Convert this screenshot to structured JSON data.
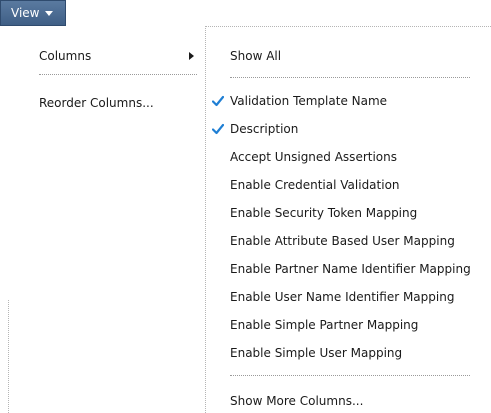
{
  "toolbar": {
    "view_label": "View"
  },
  "view_menu": {
    "items": [
      {
        "label": "Columns",
        "has_submenu": true
      },
      {
        "label": "Reorder Columns..."
      }
    ]
  },
  "columns_submenu": {
    "show_all_label": "Show All",
    "columns": [
      {
        "label": "Validation Template Name",
        "checked": true
      },
      {
        "label": "Description",
        "checked": true
      },
      {
        "label": "Accept Unsigned Assertions",
        "checked": false
      },
      {
        "label": "Enable Credential Validation",
        "checked": false
      },
      {
        "label": "Enable Security Token Mapping",
        "checked": false
      },
      {
        "label": "Enable Attribute Based User Mapping",
        "checked": false
      },
      {
        "label": "Enable Partner Name Identifier Mapping",
        "checked": false
      },
      {
        "label": "Enable User Name Identifier Mapping",
        "checked": false
      },
      {
        "label": "Enable Simple Partner Mapping",
        "checked": false
      },
      {
        "label": "Enable Simple User Mapping",
        "checked": false
      }
    ],
    "show_more_label": "Show More Columns..."
  },
  "colors": {
    "view_button": "#4a6a92",
    "checkmark": "#1f7fd4",
    "text": "#1a1a1a"
  },
  "icons": {
    "view_dropdown": "chevron-down-icon",
    "submenu": "submenu-arrow-icon",
    "checked": "checkmark-icon"
  }
}
